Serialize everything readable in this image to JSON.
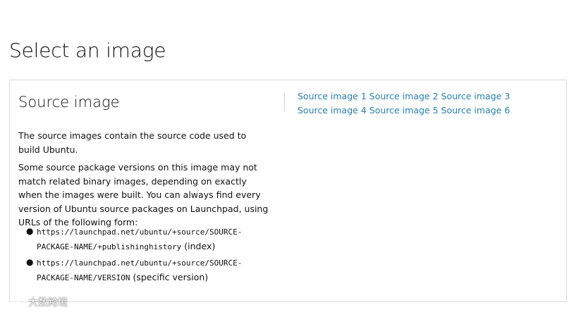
{
  "page": {
    "title": "Select an image"
  },
  "card": {
    "heading": "Source image",
    "paragraph_1": "The source images contain the source code used to build Ubuntu.",
    "paragraph_2": "Some source package versions on this image may not match related binary images, depending on exactly when the images were built. You can always find every version of Ubuntu source packages on Launchpad, using URLs of the following form:",
    "urls": [
      {
        "code": "https://launchpad.net/ubuntu/+source/SOURCE-PACKAGE-NAME/+publishinghistory",
        "note": " (index)"
      },
      {
        "code": "https://launchpad.net/ubuntu/+source/SOURCE-PACKAGE-NAME/VERSION",
        "note": " (specific version)"
      }
    ],
    "links": [
      "Source image 1",
      "Source image 2",
      "Source image 3",
      "Source image 4",
      "Source image 5",
      "Source image 6"
    ]
  },
  "colors": {
    "link": "#2d7ea8",
    "border": "#d9d9d9",
    "text": "#111111"
  },
  "watermark": {
    "text": "大数跨境",
    "icon": "watermark-logo-icon"
  }
}
